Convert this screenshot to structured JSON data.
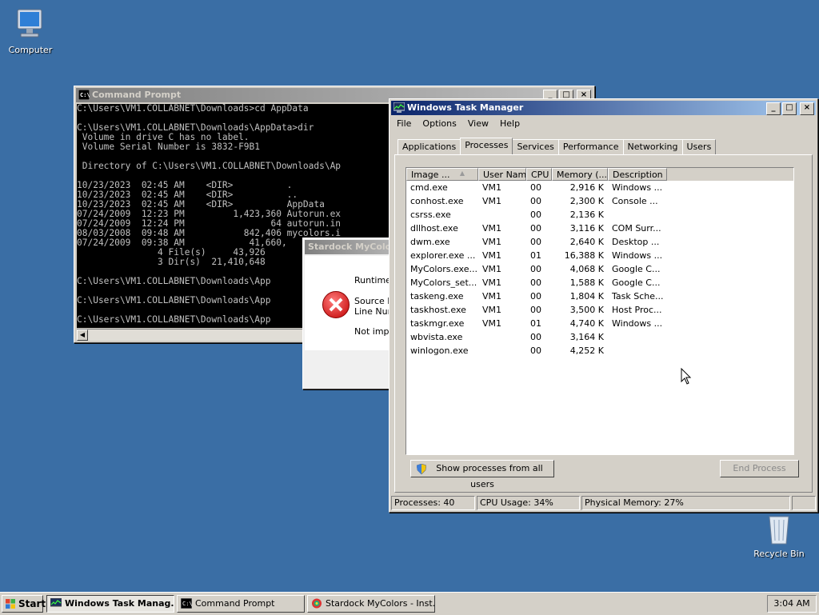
{
  "desktop": {
    "icons": [
      {
        "label": "Computer"
      },
      {
        "label": "Recycle Bin"
      }
    ]
  },
  "cmd": {
    "title": "Command Prompt",
    "lines": [
      "C:\\Users\\VM1.COLLABNET\\Downloads>cd AppData",
      "",
      "C:\\Users\\VM1.COLLABNET\\Downloads\\AppData>dir",
      " Volume in drive C has no label.",
      " Volume Serial Number is 3832-F9B1",
      "",
      " Directory of C:\\Users\\VM1.COLLABNET\\Downloads\\Ap",
      "",
      "10/23/2023  02:45 AM    <DIR>          .",
      "10/23/2023  02:45 AM    <DIR>          ..",
      "10/23/2023  02:45 AM    <DIR>          AppData",
      "07/24/2009  12:23 PM         1,423,360 Autorun.ex",
      "07/24/2009  12:24 PM                64 autorun.in",
      "08/03/2008  09:48 AM           842,406 mycolors.i",
      "07/24/2009  09:38 AM            41,660,",
      "               4 File(s)     43,926",
      "               3 Dir(s)  21,410,648",
      "",
      "C:\\Users\\VM1.COLLABNET\\Downloads\\App",
      "",
      "C:\\Users\\VM1.COLLABNET\\Downloads\\App",
      "",
      "C:\\Users\\VM1.COLLABNET\\Downloads\\App"
    ]
  },
  "dialog": {
    "title": "Stardock MyColors",
    "runtime": "Runtime",
    "source": "Source F",
    "line": "Line Num",
    "notimpl": "Not imple"
  },
  "taskmgr": {
    "title": "Windows Task Manager",
    "menu": [
      "File",
      "Options",
      "View",
      "Help"
    ],
    "tabs": [
      "Applications",
      "Processes",
      "Services",
      "Performance",
      "Networking",
      "Users"
    ],
    "active_tab": "Processes",
    "columns": [
      "Image ...",
      "User Name",
      "CPU",
      "Memory (...",
      "Description"
    ],
    "rows": [
      {
        "image": "cmd.exe",
        "user": "VM1",
        "cpu": "00",
        "mem": "2,916 K",
        "desc": "Windows ..."
      },
      {
        "image": "conhost.exe",
        "user": "VM1",
        "cpu": "00",
        "mem": "2,300 K",
        "desc": "Console ..."
      },
      {
        "image": "csrss.exe",
        "user": "",
        "cpu": "00",
        "mem": "2,136 K",
        "desc": ""
      },
      {
        "image": "dllhost.exe",
        "user": "VM1",
        "cpu": "00",
        "mem": "3,116 K",
        "desc": "COM Surr..."
      },
      {
        "image": "dwm.exe",
        "user": "VM1",
        "cpu": "00",
        "mem": "2,640 K",
        "desc": "Desktop ..."
      },
      {
        "image": "explorer.exe ...",
        "user": "VM1",
        "cpu": "01",
        "mem": "16,388 K",
        "desc": "Windows ..."
      },
      {
        "image": "MyColors.exe...",
        "user": "VM1",
        "cpu": "00",
        "mem": "4,068 K",
        "desc": "Google C..."
      },
      {
        "image": "MyColors_set...",
        "user": "VM1",
        "cpu": "00",
        "mem": "1,588 K",
        "desc": "Google C..."
      },
      {
        "image": "taskeng.exe",
        "user": "VM1",
        "cpu": "00",
        "mem": "1,804 K",
        "desc": "Task Sche..."
      },
      {
        "image": "taskhost.exe",
        "user": "VM1",
        "cpu": "00",
        "mem": "3,500 K",
        "desc": "Host Proc..."
      },
      {
        "image": "taskmgr.exe",
        "user": "VM1",
        "cpu": "01",
        "mem": "4,740 K",
        "desc": "Windows ..."
      },
      {
        "image": "wbvista.exe",
        "user": "",
        "cpu": "00",
        "mem": "3,164 K",
        "desc": ""
      },
      {
        "image": "winlogon.exe",
        "user": "",
        "cpu": "00",
        "mem": "4,252 K",
        "desc": ""
      }
    ],
    "show_all_label": "Show processes from all users",
    "end_process_label": "End Process",
    "status": {
      "processes": "Processes: 40",
      "cpu": "CPU Usage: 34%",
      "memory": "Physical Memory: 27%"
    }
  },
  "taskbar": {
    "start": "Start",
    "items": [
      "Windows Task Manag...",
      "Command Prompt",
      "Stardock MyColors - Inst..."
    ],
    "clock": "3:04 AM"
  }
}
